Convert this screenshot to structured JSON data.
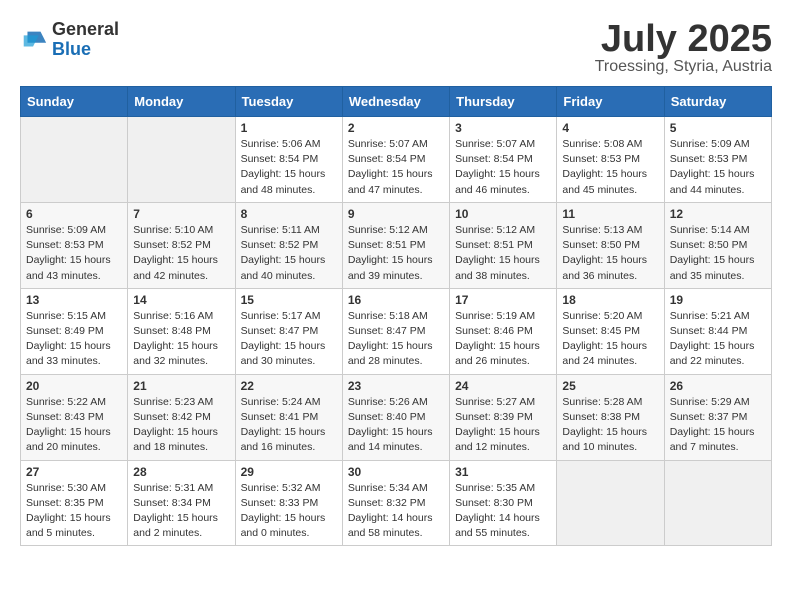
{
  "logo": {
    "general": "General",
    "blue": "Blue"
  },
  "title": {
    "month_year": "July 2025",
    "location": "Troessing, Styria, Austria"
  },
  "headers": [
    "Sunday",
    "Monday",
    "Tuesday",
    "Wednesday",
    "Thursday",
    "Friday",
    "Saturday"
  ],
  "weeks": [
    [
      {
        "day": "",
        "info": ""
      },
      {
        "day": "",
        "info": ""
      },
      {
        "day": "1",
        "info": "Sunrise: 5:06 AM\nSunset: 8:54 PM\nDaylight: 15 hours and 48 minutes."
      },
      {
        "day": "2",
        "info": "Sunrise: 5:07 AM\nSunset: 8:54 PM\nDaylight: 15 hours and 47 minutes."
      },
      {
        "day": "3",
        "info": "Sunrise: 5:07 AM\nSunset: 8:54 PM\nDaylight: 15 hours and 46 minutes."
      },
      {
        "day": "4",
        "info": "Sunrise: 5:08 AM\nSunset: 8:53 PM\nDaylight: 15 hours and 45 minutes."
      },
      {
        "day": "5",
        "info": "Sunrise: 5:09 AM\nSunset: 8:53 PM\nDaylight: 15 hours and 44 minutes."
      }
    ],
    [
      {
        "day": "6",
        "info": "Sunrise: 5:09 AM\nSunset: 8:53 PM\nDaylight: 15 hours and 43 minutes."
      },
      {
        "day": "7",
        "info": "Sunrise: 5:10 AM\nSunset: 8:52 PM\nDaylight: 15 hours and 42 minutes."
      },
      {
        "day": "8",
        "info": "Sunrise: 5:11 AM\nSunset: 8:52 PM\nDaylight: 15 hours and 40 minutes."
      },
      {
        "day": "9",
        "info": "Sunrise: 5:12 AM\nSunset: 8:51 PM\nDaylight: 15 hours and 39 minutes."
      },
      {
        "day": "10",
        "info": "Sunrise: 5:12 AM\nSunset: 8:51 PM\nDaylight: 15 hours and 38 minutes."
      },
      {
        "day": "11",
        "info": "Sunrise: 5:13 AM\nSunset: 8:50 PM\nDaylight: 15 hours and 36 minutes."
      },
      {
        "day": "12",
        "info": "Sunrise: 5:14 AM\nSunset: 8:50 PM\nDaylight: 15 hours and 35 minutes."
      }
    ],
    [
      {
        "day": "13",
        "info": "Sunrise: 5:15 AM\nSunset: 8:49 PM\nDaylight: 15 hours and 33 minutes."
      },
      {
        "day": "14",
        "info": "Sunrise: 5:16 AM\nSunset: 8:48 PM\nDaylight: 15 hours and 32 minutes."
      },
      {
        "day": "15",
        "info": "Sunrise: 5:17 AM\nSunset: 8:47 PM\nDaylight: 15 hours and 30 minutes."
      },
      {
        "day": "16",
        "info": "Sunrise: 5:18 AM\nSunset: 8:47 PM\nDaylight: 15 hours and 28 minutes."
      },
      {
        "day": "17",
        "info": "Sunrise: 5:19 AM\nSunset: 8:46 PM\nDaylight: 15 hours and 26 minutes."
      },
      {
        "day": "18",
        "info": "Sunrise: 5:20 AM\nSunset: 8:45 PM\nDaylight: 15 hours and 24 minutes."
      },
      {
        "day": "19",
        "info": "Sunrise: 5:21 AM\nSunset: 8:44 PM\nDaylight: 15 hours and 22 minutes."
      }
    ],
    [
      {
        "day": "20",
        "info": "Sunrise: 5:22 AM\nSunset: 8:43 PM\nDaylight: 15 hours and 20 minutes."
      },
      {
        "day": "21",
        "info": "Sunrise: 5:23 AM\nSunset: 8:42 PM\nDaylight: 15 hours and 18 minutes."
      },
      {
        "day": "22",
        "info": "Sunrise: 5:24 AM\nSunset: 8:41 PM\nDaylight: 15 hours and 16 minutes."
      },
      {
        "day": "23",
        "info": "Sunrise: 5:26 AM\nSunset: 8:40 PM\nDaylight: 15 hours and 14 minutes."
      },
      {
        "day": "24",
        "info": "Sunrise: 5:27 AM\nSunset: 8:39 PM\nDaylight: 15 hours and 12 minutes."
      },
      {
        "day": "25",
        "info": "Sunrise: 5:28 AM\nSunset: 8:38 PM\nDaylight: 15 hours and 10 minutes."
      },
      {
        "day": "26",
        "info": "Sunrise: 5:29 AM\nSunset: 8:37 PM\nDaylight: 15 hours and 7 minutes."
      }
    ],
    [
      {
        "day": "27",
        "info": "Sunrise: 5:30 AM\nSunset: 8:35 PM\nDaylight: 15 hours and 5 minutes."
      },
      {
        "day": "28",
        "info": "Sunrise: 5:31 AM\nSunset: 8:34 PM\nDaylight: 15 hours and 2 minutes."
      },
      {
        "day": "29",
        "info": "Sunrise: 5:32 AM\nSunset: 8:33 PM\nDaylight: 15 hours and 0 minutes."
      },
      {
        "day": "30",
        "info": "Sunrise: 5:34 AM\nSunset: 8:32 PM\nDaylight: 14 hours and 58 minutes."
      },
      {
        "day": "31",
        "info": "Sunrise: 5:35 AM\nSunset: 8:30 PM\nDaylight: 14 hours and 55 minutes."
      },
      {
        "day": "",
        "info": ""
      },
      {
        "day": "",
        "info": ""
      }
    ]
  ]
}
